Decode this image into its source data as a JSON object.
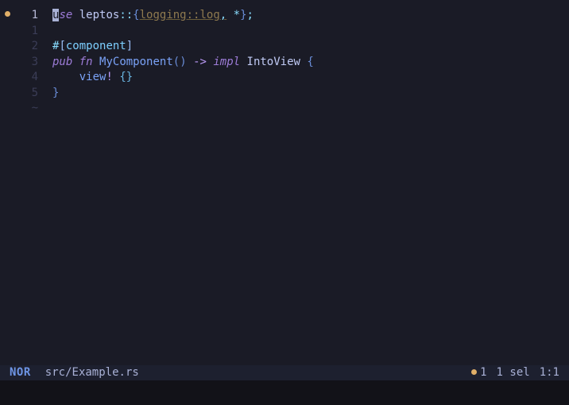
{
  "colors": {
    "bg": "#1a1b26",
    "statusbar_bg": "#1d202f",
    "accent": "#e0af68"
  },
  "gutter": {
    "active": "1",
    "rel1": "1",
    "rel2": "2",
    "rel3": "3",
    "rel4": "4",
    "rel5": "5",
    "tilde": "~"
  },
  "code": {
    "line1": {
      "use_u": "u",
      "use_se": "se",
      "sp1": " ",
      "leptos": "leptos",
      "dcolon": "::",
      "lbrace": "{",
      "logging_log": "logging::log",
      "comma": ",",
      "sp2": " ",
      "star": "*",
      "rbrace": "}",
      "semi": ";"
    },
    "line2_blank": "",
    "line3": {
      "hash": "#",
      "lbr": "[",
      "component": "component",
      "rbr": "]"
    },
    "line4": {
      "pub": "pub",
      "sp1": " ",
      "fn": "fn",
      "sp2": " ",
      "name": "MyComponent",
      "lpar": "(",
      "rpar": ")",
      "sp3": " ",
      "arrow": "->",
      "sp4": " ",
      "impl": "impl",
      "sp5": " ",
      "intoview": "IntoView",
      "sp6": " ",
      "lbrace": "{"
    },
    "line5": {
      "indent": "    ",
      "view": "view",
      "bang": "!",
      "sp": " ",
      "lbrace": "{",
      "rbrace": "}"
    },
    "line6": {
      "rbrace": "}"
    }
  },
  "status": {
    "mode": "NOR",
    "file": "src/Example.rs",
    "diag": "1",
    "sel": "1 sel",
    "pos": "1:1"
  }
}
